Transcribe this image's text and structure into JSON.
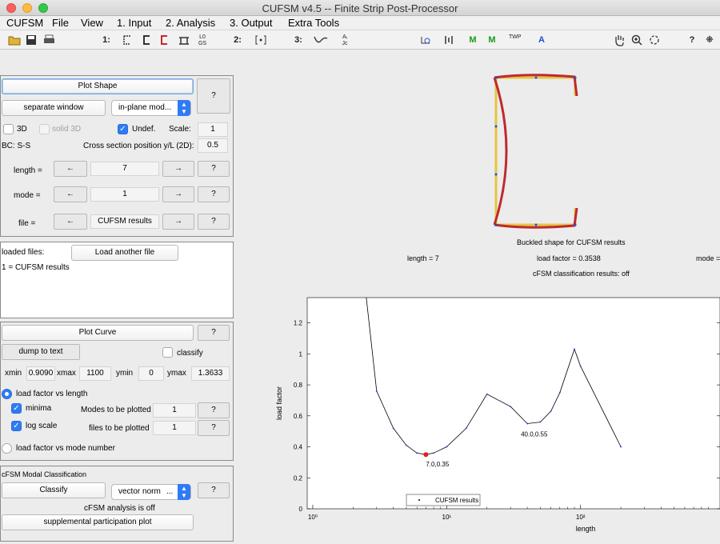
{
  "window": {
    "title": "CUFSM v4.5 -- Finite Strip Post-Processor"
  },
  "menu": [
    "CUFSM",
    "File",
    "View",
    "1. Input",
    "2. Analysis",
    "3. Output",
    "Extra Tools"
  ],
  "toolbar": {
    "icons": [
      "open-folder-icon",
      "save-icon",
      "print-icon"
    ],
    "group1_label": "1:",
    "group1_icons": [
      "section-builder-icon",
      "c-section-icon",
      "template-icon",
      "boundary-icon",
      "loading-icon"
    ],
    "group1_loads": "L0\nGS",
    "group2_label": "2:",
    "group2_icons": [
      "bracket-icon"
    ],
    "group3_label": "3:",
    "group3_icons": [
      "buckling-curve-icon",
      "classification-icon"
    ],
    "group3_aic": "Aᵢ\nJc",
    "right_icons": [
      "node-edit-icon",
      "fixity-icon",
      "m-green-icon",
      "m-green2-icon",
      "twp-icon",
      "a-blue-icon"
    ],
    "m_label": "M",
    "twp_label": "TWP",
    "a_label": "A",
    "nav_icons": [
      "pan-hand-icon",
      "zoom-in-icon",
      "rotate-icon"
    ],
    "help": "?",
    "datacursor": "⁜"
  },
  "shape_panel": {
    "plot_shape": "Plot Shape",
    "help": "?",
    "separate_window": "separate window",
    "mode_select": "in-plane mod...",
    "cb_3d": "3D",
    "cb_solid3d": "solid 3D",
    "cb_undef": "Undef.",
    "scale_label": "Scale:",
    "scale_value": "1",
    "bc": "BC: S-S",
    "cross_label": "Cross section position y/L (2D):",
    "cross_value": "0.5",
    "rows": [
      {
        "label": "length =",
        "value": "7"
      },
      {
        "label": "mode =",
        "value": "1"
      },
      {
        "label": "file =",
        "value": "CUFSM results"
      }
    ],
    "left_arrow": "←",
    "right_arrow": "→"
  },
  "files_panel": {
    "loaded_label": "loaded files:",
    "load_button": "Load another file",
    "entry": "1 = CUFSM results"
  },
  "curve_panel": {
    "plot_curve": "Plot Curve",
    "help": "?",
    "dump": "dump to text",
    "classify": "classify",
    "xmin_label": "xmin",
    "xmin": "0.9090",
    "xmax_label": "xmax",
    "xmax": "1100",
    "ymin_label": "ymin",
    "ymin": "0",
    "ymax_label": "ymax",
    "ymax": "1.3633",
    "radio_lf_length": "load factor vs length",
    "minima": "minima",
    "modes_label": "Modes to be plotted",
    "modes_value": "1",
    "logscale": "log scale",
    "files_label": "files to be plotted",
    "files_value": "1",
    "radio_lf_mode": "load factor vs mode number"
  },
  "cfsm_panel": {
    "title": "cFSM Modal Classification",
    "classify": "Classify",
    "vector": "vector norm",
    "vector_dots": "...",
    "help": "?",
    "status": "cFSM analysis is off",
    "supplemental": "supplemental participation plot"
  },
  "shape_view": {
    "caption": "Buckled shape for  CUFSM results",
    "length_text": "length =  7",
    "load_text": "load factor =  0.3538",
    "mode_text": "mode =",
    "classification": "cFSM classification results: off"
  },
  "chart_data": {
    "type": "line",
    "xscale": "log",
    "xlabel": "length",
    "ylabel": "load factor",
    "xlim": [
      0.909,
      1100
    ],
    "ylim": [
      0,
      1.3633
    ],
    "yticks": [
      "0",
      "0.2",
      "0.4",
      "0.6",
      "0.8",
      "1",
      "1.2"
    ],
    "xticks": [
      "10⁰",
      "10¹",
      "10²"
    ],
    "legend": "CUFSM results",
    "legend_placement": "bottom-center",
    "series": [
      {
        "name": "CUFSM results",
        "x": [
          2.5,
          3.0,
          4.0,
          5.0,
          6.0,
          7.0,
          8.0,
          10.0,
          14.0,
          20.0,
          30.0,
          40.0,
          50.0,
          60.0,
          70.0,
          90.0,
          100.0,
          200.0
        ],
        "y": [
          1.38,
          0.76,
          0.52,
          0.41,
          0.36,
          0.35,
          0.36,
          0.4,
          0.52,
          0.74,
          0.66,
          0.55,
          0.56,
          0.63,
          0.75,
          1.03,
          0.92,
          0.4
        ]
      }
    ],
    "annotations": [
      {
        "x": 7.0,
        "y": 0.35,
        "text": "7.0,0.35",
        "highlight": true
      },
      {
        "x": 40.0,
        "y": 0.55,
        "text": "40.0,0.55",
        "highlight": false
      }
    ]
  },
  "colors": {
    "accent": "#2f7bf6",
    "curve": "#c0282f",
    "undeformed": "#e5c640",
    "marker": "#e02020"
  }
}
